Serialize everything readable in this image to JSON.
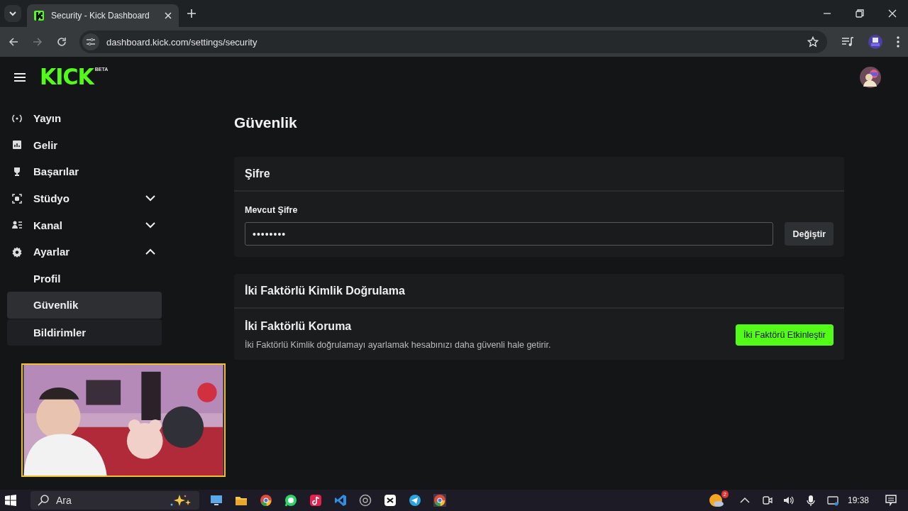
{
  "browser": {
    "tab": {
      "title": "Security - Kick Dashboard",
      "selected": true
    },
    "address": "dashboard.kick.com/settings/security"
  },
  "header": {
    "logo": "KICK",
    "logo_badge": "BETA"
  },
  "sidebar": {
    "items": [
      {
        "label": "Yayın"
      },
      {
        "label": "Gelir"
      },
      {
        "label": "Başarılar"
      },
      {
        "label": "Stüdyo",
        "expanded": false
      },
      {
        "label": "Kanal",
        "expanded": false
      },
      {
        "label": "Ayarlar",
        "expanded": true,
        "children": [
          {
            "label": "Profil",
            "selected": false,
            "hovered": false
          },
          {
            "label": "Güvenlik",
            "selected": true,
            "hovered": false
          },
          {
            "label": "Bildirimler",
            "selected": false,
            "hovered": true
          }
        ]
      }
    ]
  },
  "page": {
    "title": "Güvenlik",
    "password": {
      "title": "Şifre",
      "field_label": "Mevcut Şifre",
      "value": "••••••••",
      "button": "Değiştir"
    },
    "two_factor": {
      "title": "İki Faktörlü Kimlik Doğrulama",
      "subtitle": "İki Faktörlü Koruma",
      "description": "İki Faktörlü Kimlik doğrulamayı ayarlamak hesabınızı daha güvenli hale getirir.",
      "button": "İki Faktörü Etkinleştir"
    }
  },
  "taskbar": {
    "search_placeholder": "Ara",
    "weather_badge": "2",
    "time": "19:38"
  }
}
